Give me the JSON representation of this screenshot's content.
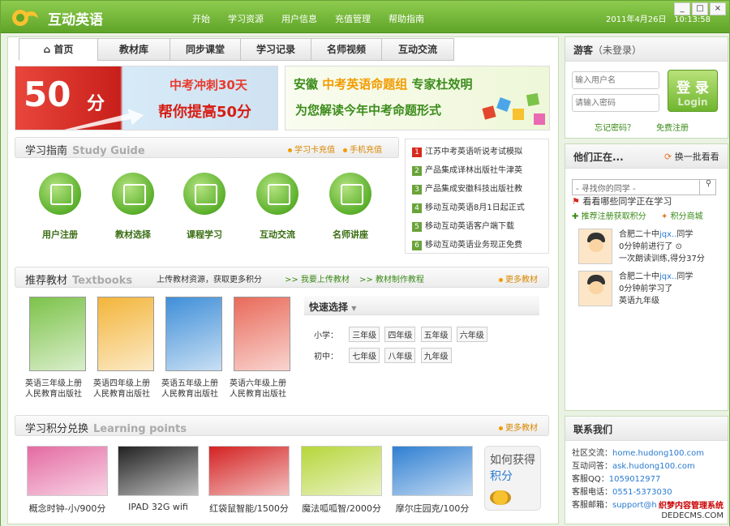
{
  "app": {
    "title": "互动英语",
    "date": "2011年4月26日",
    "time": "10:13:58"
  },
  "topnav": [
    "开始",
    "学习资源",
    "用户信息",
    "充值管理",
    "帮助指南"
  ],
  "window_buttons": [
    "_",
    "□",
    "×"
  ],
  "tabs": [
    "首页",
    "教材库",
    "同步课堂",
    "学习记录",
    "名师视频",
    "互动交流"
  ],
  "banner_left": {
    "big": "50",
    "unit": "分",
    "line1": "中考冲刺30天",
    "line2": "帮你提高50分"
  },
  "banner_right": {
    "prefix": "安徽",
    "highlight": "中考英语命题组",
    "suffix": "专家杜效明",
    "line2": "为您解读今年中考命题形式"
  },
  "study_guide": {
    "title": "学习指南",
    "title_en": "Study Guide",
    "link1": "学习卡充值",
    "link2": "手机充值",
    "icons": [
      "用户注册",
      "教材选择",
      "课程学习",
      "互动交流",
      "名师讲座"
    ]
  },
  "news": [
    {
      "n": "1",
      "text": "江苏中考英语听说考试模拟"
    },
    {
      "n": "2",
      "text": "产品集成译林出版社牛津英"
    },
    {
      "n": "3",
      "text": "产品集成安徽科技出版社教"
    },
    {
      "n": "4",
      "text": "移动互动英语8月1日起正式"
    },
    {
      "n": "5",
      "text": "移动互动英语客户端下载"
    },
    {
      "n": "6",
      "text": "移动互动英语业务现正免费"
    }
  ],
  "textbooks": {
    "title": "推荐教材",
    "title_en": "Textbooks",
    "desc": "上传教材资源，获取更多积分",
    "link1": ">> 我要上传教材",
    "link2": ">> 教材制作教程",
    "more": "更多教材",
    "books": [
      {
        "line1": "英语三年级上册",
        "line2": "人民教育出版社",
        "color": "#7cc34a"
      },
      {
        "line1": "英语四年级上册",
        "line2": "人民教育出版社",
        "color": "#f3b53a"
      },
      {
        "line1": "英语五年级上册",
        "line2": "人民教育出版社",
        "color": "#3f8fd8"
      },
      {
        "line1": "英语六年级上册",
        "line2": "人民教育出版社",
        "color": "#e96a5a"
      }
    ]
  },
  "quick_select": {
    "title": "快速选择",
    "primary_label": "小学：",
    "primary": [
      "三年级",
      "四年级",
      "五年级",
      "六年级"
    ],
    "junior_label": "初中：",
    "junior": [
      "七年级",
      "八年级",
      "九年级"
    ]
  },
  "points": {
    "title": "学习积分兑换",
    "title_en": "Learning points",
    "more": "更多教材",
    "items": [
      {
        "label": "概念时钟-小/900分",
        "color": "#e46aa2"
      },
      {
        "label": "IPAD 32G wifi",
        "color": "#222"
      },
      {
        "label": "红袋鼠智能/1500分",
        "color": "#d42222"
      },
      {
        "label": "魔法呱呱智/2000分",
        "color": "#b6d63a"
      },
      {
        "label": "摩尔庄园克/100分",
        "color": "#2f7fd2"
      }
    ],
    "how": {
      "line1": "如何获得",
      "line2": "积分"
    }
  },
  "login": {
    "title": "游客",
    "title_sub": "（未登录）",
    "user_placeholder": "输入用户名",
    "pass_placeholder": "请输入密码",
    "button": "登 录",
    "button_en": "Login",
    "forgot": "忘记密码？",
    "register": "免费注册"
  },
  "activity": {
    "title": "他们正在...",
    "refresh": "换一批看看",
    "search_placeholder": "- 寻找你的同学 -",
    "see": "看看哪些同学正在学习",
    "reco": "推荐注册获取积分",
    "shop": "积分商城",
    "feed": [
      {
        "l1a": "合肥二十中",
        "l1b": "jqx..",
        "l1c": "同学",
        "l2": "0分钟前进行了",
        "l3": "一次朗读训练,得分37分"
      },
      {
        "l1a": "合肥二十中",
        "l1b": "jqx..",
        "l1c": "同学",
        "l2": "0分钟前学习了",
        "l3": "英语九年级"
      }
    ]
  },
  "contact": {
    "title": "联系我们",
    "rows": [
      {
        "k": "社区交流：",
        "v": "home.hudong100.com"
      },
      {
        "k": "互动问答：",
        "v": "ask.hudong100.com"
      },
      {
        "k": "客服QQ：",
        "v": "1059012977"
      },
      {
        "k": "客服电话：",
        "v": "0551-5373030"
      },
      {
        "k": "客服邮箱：",
        "v": "support@hudong100.com"
      }
    ]
  },
  "watermark": {
    "line1": "织梦内容管理系统",
    "line2": "DEDECMS.COM"
  }
}
